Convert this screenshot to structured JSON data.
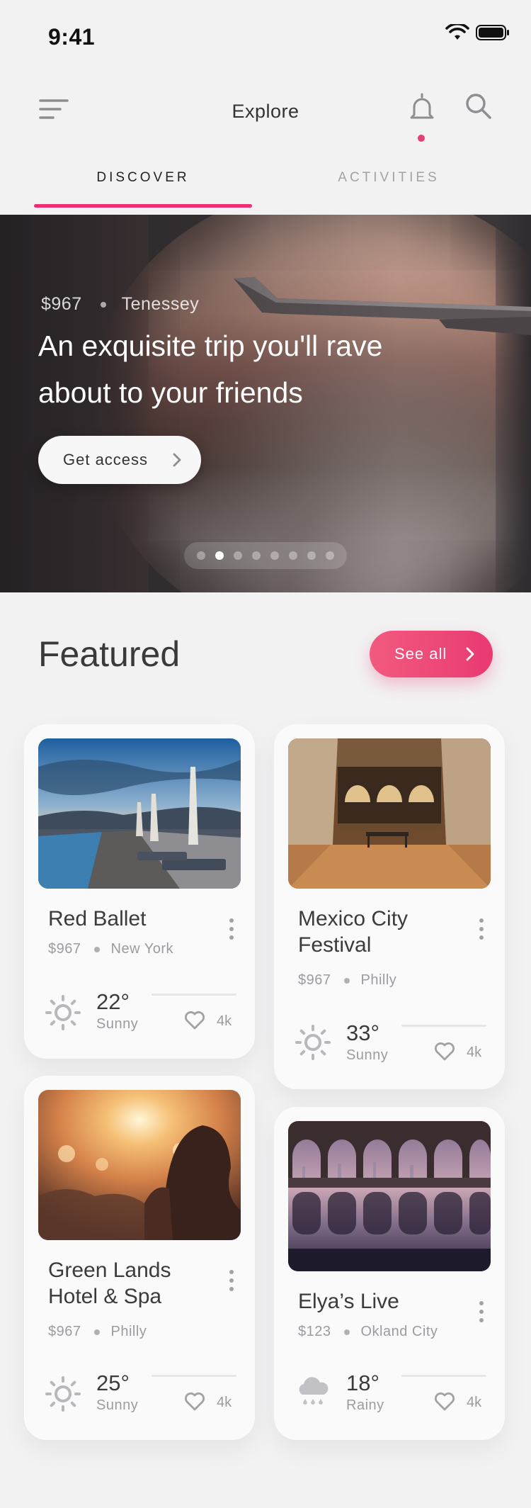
{
  "status_bar": {
    "time": "9:41"
  },
  "header": {
    "title": "Explore"
  },
  "tabs": [
    {
      "label": "DISCOVER",
      "active": true
    },
    {
      "label": "ACTIVITIES",
      "active": false
    }
  ],
  "hero": {
    "price": "$967",
    "location": "Tenessey",
    "title": "An exquisite trip you'll rave about to your friends",
    "button_label": "Get access",
    "pager": {
      "total": 8,
      "active_index": 1
    }
  },
  "featured": {
    "title": "Featured",
    "see_all_label": "See all"
  },
  "cards": [
    {
      "name": "Red Ballet",
      "price": "$967",
      "location": "New York",
      "temp": "22°",
      "condition": "Sunny",
      "likes": "4k",
      "weather_icon": "sun-icon"
    },
    {
      "name": "Mexico City Festival",
      "price": "$967",
      "location": "Philly",
      "temp": "33°",
      "condition": "Sunny",
      "likes": "4k",
      "weather_icon": "sun-icon"
    },
    {
      "name": "Green Lands Hotel & Spa",
      "price": "$967",
      "location": "Philly",
      "temp": "25°",
      "condition": "Sunny",
      "likes": "4k",
      "weather_icon": "sun-icon"
    },
    {
      "name": "Elya’s Live",
      "price": "$123",
      "location": "Okland City",
      "temp": "18°",
      "condition": "Rainy",
      "likes": "4k",
      "weather_icon": "rain-cloud-icon"
    }
  ],
  "colors": {
    "accent": "#ea3d75",
    "background": "#f2f2f3",
    "card": "#fafafa"
  }
}
